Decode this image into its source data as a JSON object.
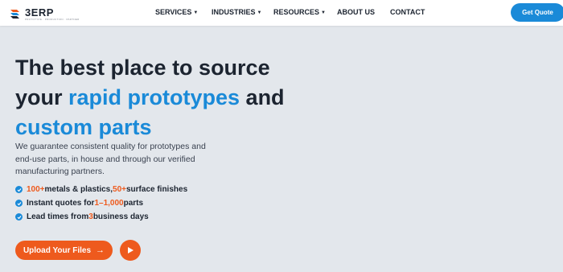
{
  "brand": {
    "name": "3ERP",
    "tagline": "PROTOTYPE · PRODUCTION · PARTNER"
  },
  "nav": {
    "items": [
      {
        "label": "SERVICES",
        "dropdown": true
      },
      {
        "label": "INDUSTRIES",
        "dropdown": true
      },
      {
        "label": "RESOURCES",
        "dropdown": true
      },
      {
        "label": "ABOUT US",
        "dropdown": false
      },
      {
        "label": "CONTACT",
        "dropdown": false
      }
    ],
    "cta_label": "Get Quote"
  },
  "hero": {
    "title": {
      "part1": "The best place to source",
      "part2": "your ",
      "accent1": "rapid prototypes",
      "part3": " and",
      "accent2": "custom parts"
    },
    "description": "We guarantee consistent quality for prototypes and end-use parts, in house and through our verified manufacturing partners.",
    "features": [
      {
        "hl1": "100+",
        "t1": " metals & plastics, ",
        "hl2": "50+",
        "t2": " surface finishes"
      },
      {
        "t0": "Instant quotes for ",
        "hl1": "1–1,000",
        "t1": " parts"
      },
      {
        "t0": "Lead times from ",
        "hl1": "3",
        "t1": " business days"
      }
    ],
    "upload_label": "Upload Your Files",
    "upload_arrow": "→"
  },
  "colors": {
    "accent_blue": "#1a8ad8",
    "accent_orange": "#ee5a1d",
    "background": "#e3e7ec",
    "text_dark": "#1c2430"
  },
  "icons": {
    "logo": "3erp-logo-icon",
    "caret": "caret-down-icon",
    "check": "check-circle-icon",
    "arrow": "arrow-right-icon",
    "play": "play-icon"
  }
}
